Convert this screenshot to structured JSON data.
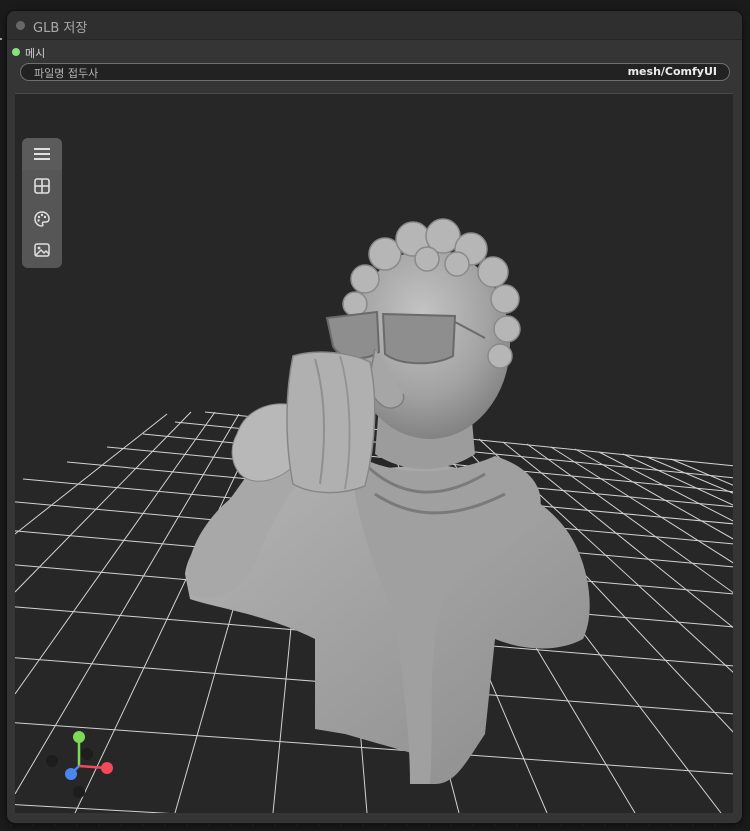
{
  "node": {
    "title": "GLB 저장",
    "input_label": "메시",
    "widget": {
      "label": "파일명 접두사",
      "value": "mesh/ComfyUI"
    }
  },
  "viewport": {
    "toolbar": {
      "buttons": [
        "menu-icon",
        "grid-icon",
        "palette-icon",
        "image-icon"
      ]
    },
    "axis_gizmo": {
      "x_color": "#f04a5b",
      "y_color": "#7ed957",
      "z_color": "#4a86f0"
    },
    "background_color": "#272727",
    "model_color": "#a8a8a8"
  }
}
